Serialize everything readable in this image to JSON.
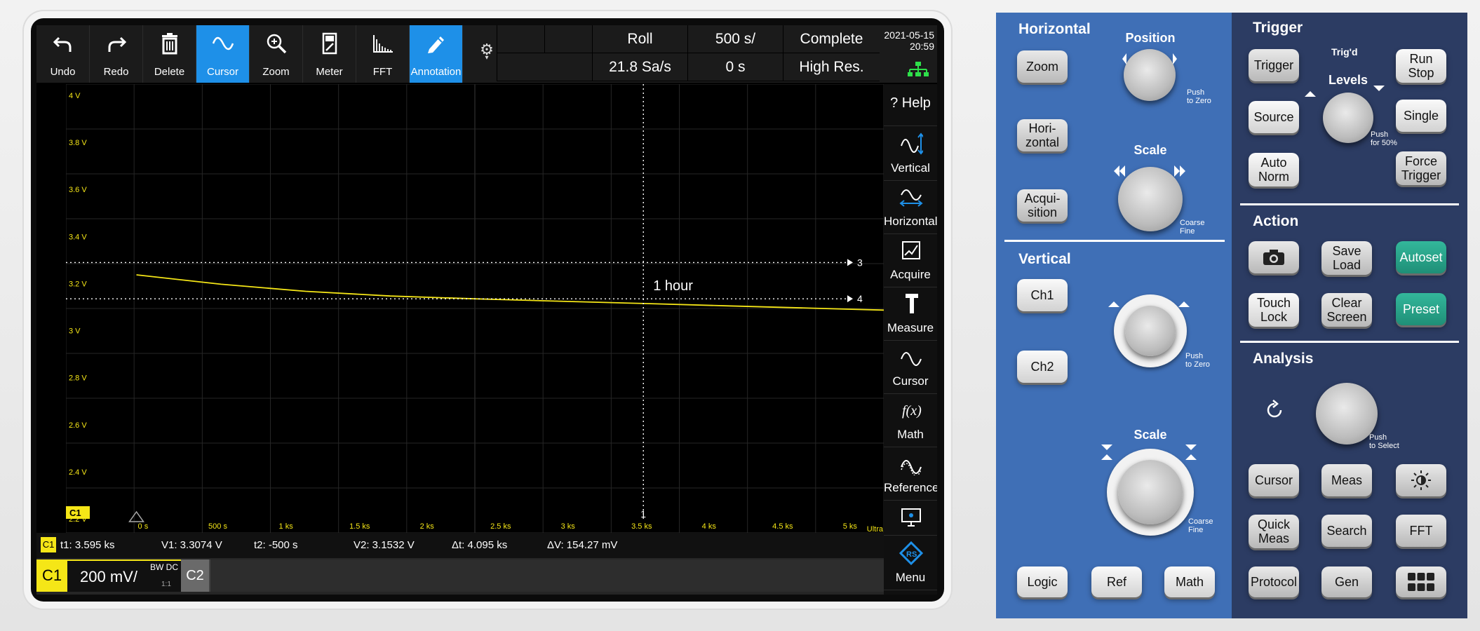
{
  "toolbar": {
    "tools": [
      {
        "label": "Undo",
        "icon": "undo-icon"
      },
      {
        "label": "Redo",
        "icon": "redo-icon"
      },
      {
        "label": "Delete",
        "icon": "trash-icon"
      },
      {
        "label": "Cursor",
        "icon": "sine-cursor-icon",
        "active": true
      },
      {
        "label": "Zoom",
        "icon": "zoom-icon"
      },
      {
        "label": "Meter",
        "icon": "meter-icon"
      },
      {
        "label": "FFT",
        "icon": "fft-icon"
      },
      {
        "label": "Annotation",
        "icon": "pen-icon",
        "active": true
      }
    ],
    "acq_mode": "Roll",
    "sample_rate": "21.8 Sa/s",
    "timebase": "500 s/",
    "position": "0 s",
    "status": "Complete",
    "resolution": "High Res.",
    "date": "2021-05-15",
    "time": "20:59"
  },
  "waveform": {
    "y_ticks": [
      "4 V",
      "3.8 V",
      "3.6 V",
      "3.4 V",
      "3.2 V",
      "3 V",
      "2.8 V",
      "2.6 V",
      "2.4 V",
      "2.2 V"
    ],
    "x_ticks": [
      "0 s",
      "500 s",
      "1 ks",
      "1.5 ks",
      "2 ks",
      "2.5 ks",
      "3 ks",
      "3.5 ks",
      "4 ks",
      "4.5 ks",
      "5 ks"
    ],
    "trace_color": "#f5e617",
    "trace_points": [
      [
        0,
        3.255
      ],
      [
        600,
        3.215
      ],
      [
        1200,
        3.185
      ],
      [
        1800,
        3.165
      ],
      [
        2400,
        3.153
      ],
      [
        3000,
        3.143
      ],
      [
        3600,
        3.133
      ],
      [
        4200,
        3.123
      ],
      [
        4800,
        3.113
      ],
      [
        5300,
        3.105
      ]
    ],
    "cursor_h3_v": 3.3074,
    "cursor_h4_v": 3.1532,
    "cursor_v1_t": 3595,
    "cursor_h3_label": "3",
    "cursor_h4_label": "4",
    "cursor_v1_label": "1",
    "annotation": "1 hour",
    "ch1_label": "C1",
    "ultra_label": "Ultra C"
  },
  "cursor_readout": {
    "ch": "C1",
    "t1": "t1: 3.595 ks",
    "v1": "V1: 3.3074 V",
    "t2": "t2: -500 s",
    "v2": "V2: 3.1532 V",
    "dt": "Δt: 4.095 ks",
    "dv": "ΔV: 154.27 mV"
  },
  "channel_bar": {
    "ch1": "C1",
    "ch1_scale": "200 mV/",
    "ch1_bw": "BW DC",
    "ch1_ratio": "1:1",
    "ch2": "C2"
  },
  "right_menu": [
    {
      "label": "? Help",
      "icon": "help-icon"
    },
    {
      "label": "Vertical",
      "icon": "vertical-icon"
    },
    {
      "label": "Horizontal",
      "icon": "horizontal-icon"
    },
    {
      "label": "Acquire",
      "icon": "acquire-icon"
    },
    {
      "label": "Measure",
      "icon": "caliper-icon"
    },
    {
      "label": "Cursor",
      "icon": "cursor-icon"
    },
    {
      "label": "Math",
      "icon": "fx-icon"
    },
    {
      "label": "References",
      "icon": "references-icon"
    },
    {
      "label": "Menu",
      "icon": "rs-logo-icon"
    }
  ],
  "panel": {
    "horizontal": {
      "title": "Horizontal",
      "zoom": "Zoom",
      "hori": "Hori-\nzontal",
      "acqui": "Acqui-\nsition",
      "position": "Position",
      "position_hint": "Push\nto Zero",
      "scale": "Scale",
      "scale_hint": "Coarse\nFine"
    },
    "vertical": {
      "title": "Vertical",
      "ch1": "Ch1",
      "ch2": "Ch2",
      "offset_hint": "Push\nto Zero",
      "scale": "Scale",
      "scale_hint": "Coarse\nFine"
    },
    "bottom": {
      "logic": "Logic",
      "ref": "Ref",
      "math": "Math"
    },
    "trigger": {
      "title": "Trigger",
      "trigger": "Trigger",
      "trigd": "Trig'd",
      "levels": "Levels",
      "levels_hint": "Push\nfor 50%",
      "run_stop": "Run\nStop",
      "source": "Source",
      "single": "Single",
      "auto_norm": "Auto\nNorm",
      "force": "Force\nTrigger"
    },
    "action": {
      "title": "Action",
      "save_load": "Save\nLoad",
      "autoset": "Autoset",
      "touch_lock": "Touch\nLock",
      "clear": "Clear\nScreen",
      "preset": "Preset"
    },
    "analysis": {
      "title": "Analysis",
      "select_hint": "Push\nto Select",
      "cursor": "Cursor",
      "meas": "Meas",
      "quick": "Quick\nMeas",
      "search": "Search",
      "fft": "FFT",
      "protocol": "Protocol",
      "gen": "Gen"
    }
  },
  "colors": {
    "accent_blue": "#1e90e8",
    "panel_blue": "#3f6fb6",
    "panel_dark": "#2c3c63",
    "green_key": "#29a58a",
    "trace_yellow": "#f5e617"
  }
}
